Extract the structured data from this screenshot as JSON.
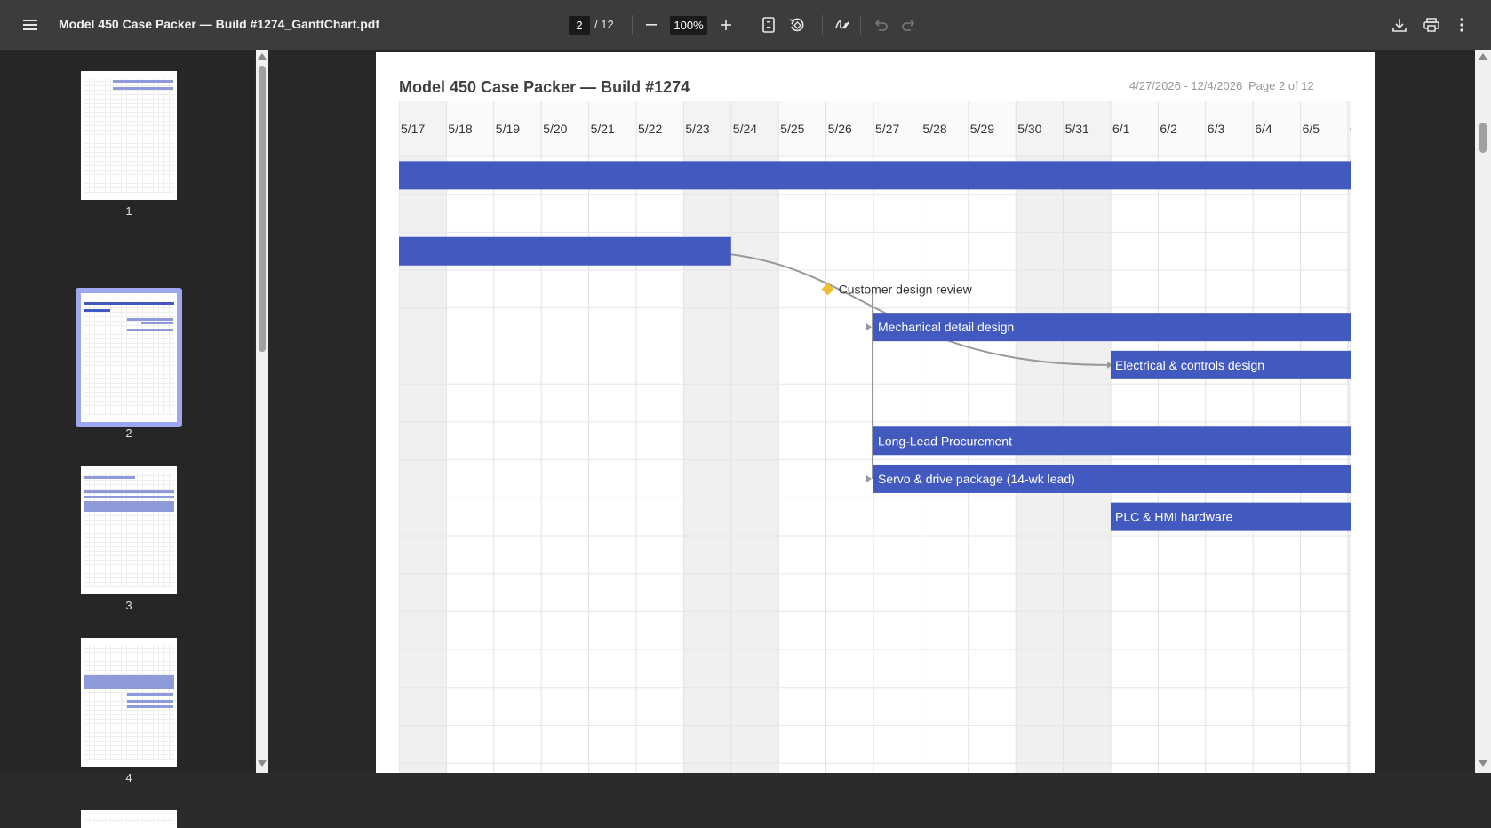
{
  "toolbar": {
    "document_title": "Model 450 Case Packer — Build #1274_GanttChart.pdf",
    "current_page": "2",
    "total_pages": "/ 12",
    "zoom": "100%",
    "icons": [
      "menu-icon",
      "zoom-out-icon",
      "zoom-in-icon",
      "fit-page-icon",
      "rotate-icon",
      "draw-icon",
      "undo-icon",
      "redo-icon",
      "download-icon",
      "print-icon",
      "more-icon"
    ]
  },
  "sidebar": {
    "thumbnails": [
      {
        "label": "1",
        "selected": false
      },
      {
        "label": "2",
        "selected": true
      },
      {
        "label": "3",
        "selected": false
      },
      {
        "label": "4",
        "selected": false
      }
    ]
  },
  "page": {
    "title": "Model 450 Case Packer — Build #1274",
    "date_range": "4/27/2026 - 12/4/2026",
    "page_indicator": "Page 2 of 12"
  },
  "chart_data": {
    "type": "gantt",
    "bar_color": "#4259bf",
    "milestone_color": "#f0c030",
    "dependency_color": "#999999",
    "weekend_color": "#f0f0f0",
    "visible_days": [
      "5/17",
      "5/18",
      "5/19",
      "5/20",
      "5/21",
      "5/22",
      "5/23",
      "5/24",
      "5/25",
      "5/26",
      "5/27",
      "5/28",
      "5/29",
      "5/30",
      "5/31",
      "6/1",
      "6/2",
      "6/3",
      "6/4",
      "6/5",
      "6"
    ],
    "weekend_indices": [
      0,
      6,
      7,
      13,
      14,
      20
    ],
    "row_count": 16,
    "tasks": [
      {
        "row": 0,
        "start": -1,
        "end": 20,
        "label": "",
        "kind": "bar"
      },
      {
        "row": 2,
        "start": -1,
        "end": 6,
        "label": "",
        "kind": "bar"
      },
      {
        "row": 3,
        "start": 9,
        "label": "Customer design review",
        "kind": "milestone"
      },
      {
        "row": 4,
        "start": 10,
        "end": 20,
        "label": "Mechanical detail design",
        "kind": "bar"
      },
      {
        "row": 5,
        "start": 15,
        "end": 20,
        "label": "Electrical & controls design",
        "kind": "bar"
      },
      {
        "row": 7,
        "start": 10,
        "end": 20,
        "label": "Long-Lead Procurement",
        "kind": "bar"
      },
      {
        "row": 8,
        "start": 10,
        "end": 20,
        "label": "Servo & drive package (14-wk lead)",
        "kind": "bar"
      },
      {
        "row": 9,
        "start": 15,
        "end": 20,
        "label": "PLC & HMI hardware",
        "kind": "bar"
      }
    ],
    "dependencies": [
      {
        "from_row": 2,
        "to_row": 5,
        "style": "curve"
      },
      {
        "from_row": 3,
        "to_row": 4,
        "style": "elbow"
      },
      {
        "from_row": 3,
        "to_row": 8,
        "style": "elbow"
      }
    ]
  }
}
